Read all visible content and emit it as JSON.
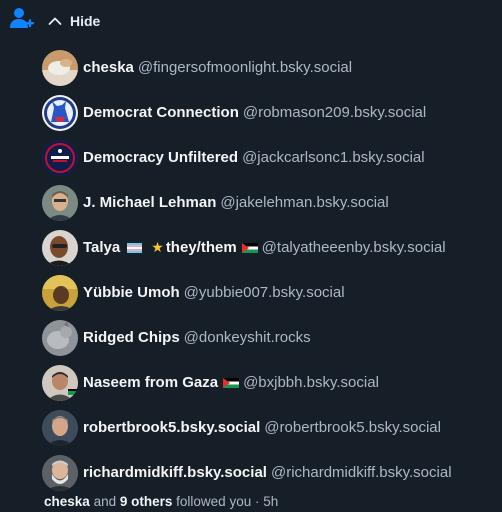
{
  "header": {
    "hide_label": "Hide"
  },
  "followers": [
    {
      "display_name": "cheska",
      "handle": "@fingersofmoonlight.bsky.social"
    },
    {
      "display_name": "Democrat Connection",
      "handle": "@robmason209.bsky.social"
    },
    {
      "display_name": "Democracy Unfiltered",
      "handle": "@jackcarlsonc1.bsky.social"
    },
    {
      "display_name": "J. Michael Lehman",
      "handle": "@jakelehman.bsky.social"
    },
    {
      "display_name_prefix": "Talya",
      "display_name_suffix": "they/them",
      "handle": "@talyatheeenby.bsky.social"
    },
    {
      "display_name": "Yübbie Umoh",
      "handle": "@yubbie007.bsky.social"
    },
    {
      "display_name": "Ridged Chips",
      "handle": "@donkeyshit.rocks"
    },
    {
      "display_name": "Naseem from Gaza",
      "handle": "@bxjbbh.bsky.social"
    },
    {
      "display_name": "robertbrook5.bsky.social",
      "handle": "@robertbrook5.bsky.social"
    },
    {
      "display_name": "richardmidkiff.bsky.social",
      "handle": "@richardmidkiff.bsky.social"
    }
  ],
  "footer": {
    "first_name": "cheska",
    "and_text": "and",
    "others_text": "9 others",
    "action_text": "followed you",
    "separator": "·",
    "time": "5h"
  },
  "colors": {
    "background": "#161e27",
    "accent": "#1083fe",
    "muted_text": "#aeb8c4"
  },
  "icons": {
    "follow": "person-plus-icon",
    "hide": "chevron-up-icon"
  }
}
